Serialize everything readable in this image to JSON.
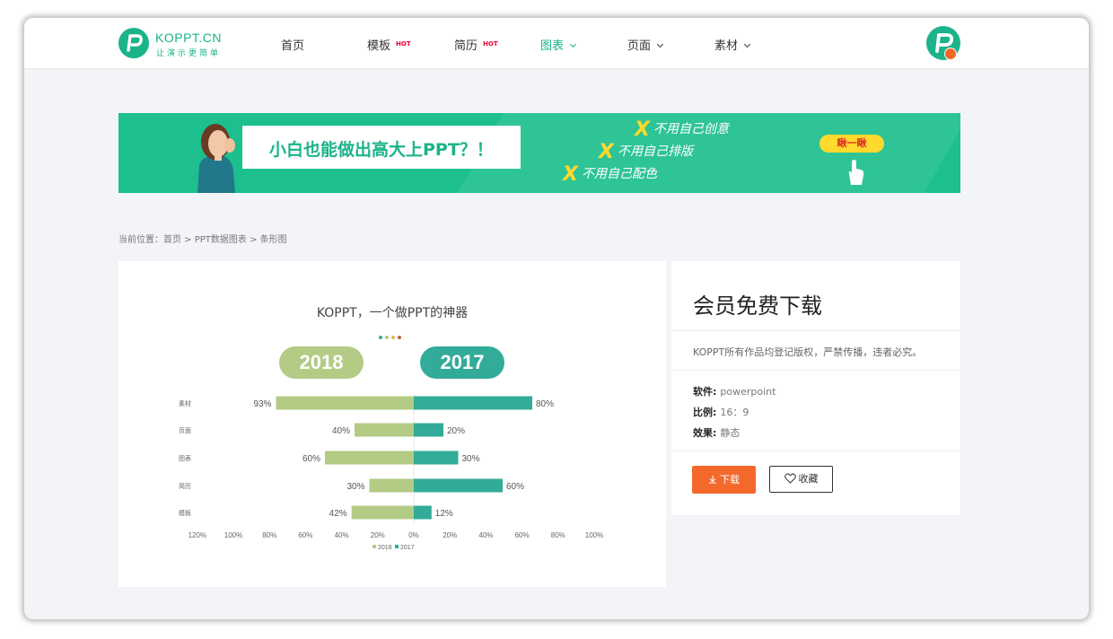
{
  "header": {
    "logo_name": "KOPPT.CN",
    "logo_slogan": "让演示更简单",
    "nav": [
      {
        "label": "首页",
        "hot": ""
      },
      {
        "label": "模板",
        "hot": "HOT"
      },
      {
        "label": "简历",
        "hot": "HOT"
      },
      {
        "label": "图表",
        "hot": ""
      },
      {
        "label": "页面",
        "hot": ""
      },
      {
        "label": "素材",
        "hot": ""
      }
    ],
    "active_nav": "图表"
  },
  "banner": {
    "headline": "小白也能做出高大上PPT？！",
    "points": [
      "不用自己创意",
      "不用自己排版",
      "不用自己配色"
    ],
    "x_mark": "X",
    "cta": "瞅一瞅"
  },
  "breadcrumb": "当前位置：首页 > PPT数据图表 > 条形图",
  "preview": {
    "chart_title": "KOPPT，一个做PPT的神器",
    "left_year": "2018",
    "right_year": "2017"
  },
  "colors": {
    "brand": "#1bb38a",
    "series_2018": "#b3cb85",
    "series_2017": "#32ab98",
    "download_button": "#f5682c"
  },
  "chart_data": {
    "type": "bar",
    "orientation": "horizontal-butterfly",
    "categories": [
      "素材",
      "页面",
      "图表",
      "简历",
      "模板"
    ],
    "series": [
      {
        "name": "2018",
        "values": [
          93,
          40,
          60,
          30,
          42
        ]
      },
      {
        "name": "2017",
        "values": [
          80,
          20,
          30,
          60,
          12
        ]
      }
    ],
    "x_ticks_left": [
      "120%",
      "100%",
      "80%",
      "60%",
      "40%",
      "20%",
      "0%"
    ],
    "x_ticks_right": [
      "20%",
      "40%",
      "60%",
      "80%",
      "100%"
    ],
    "xlim": [
      -120,
      100
    ],
    "legend": [
      "2018",
      "2017"
    ],
    "legend_position": "bottom"
  },
  "info": {
    "title": "会员免费下载",
    "notice": "KOPPT所有作品均登记版权，严禁传播，违者必究。",
    "meta": [
      {
        "key": "软件:",
        "value": "powerpoint"
      },
      {
        "key": "比例:",
        "value": "16：9"
      },
      {
        "key": "效果:",
        "value": "静态"
      }
    ],
    "download_label": "下载",
    "favorite_label": "收藏"
  }
}
